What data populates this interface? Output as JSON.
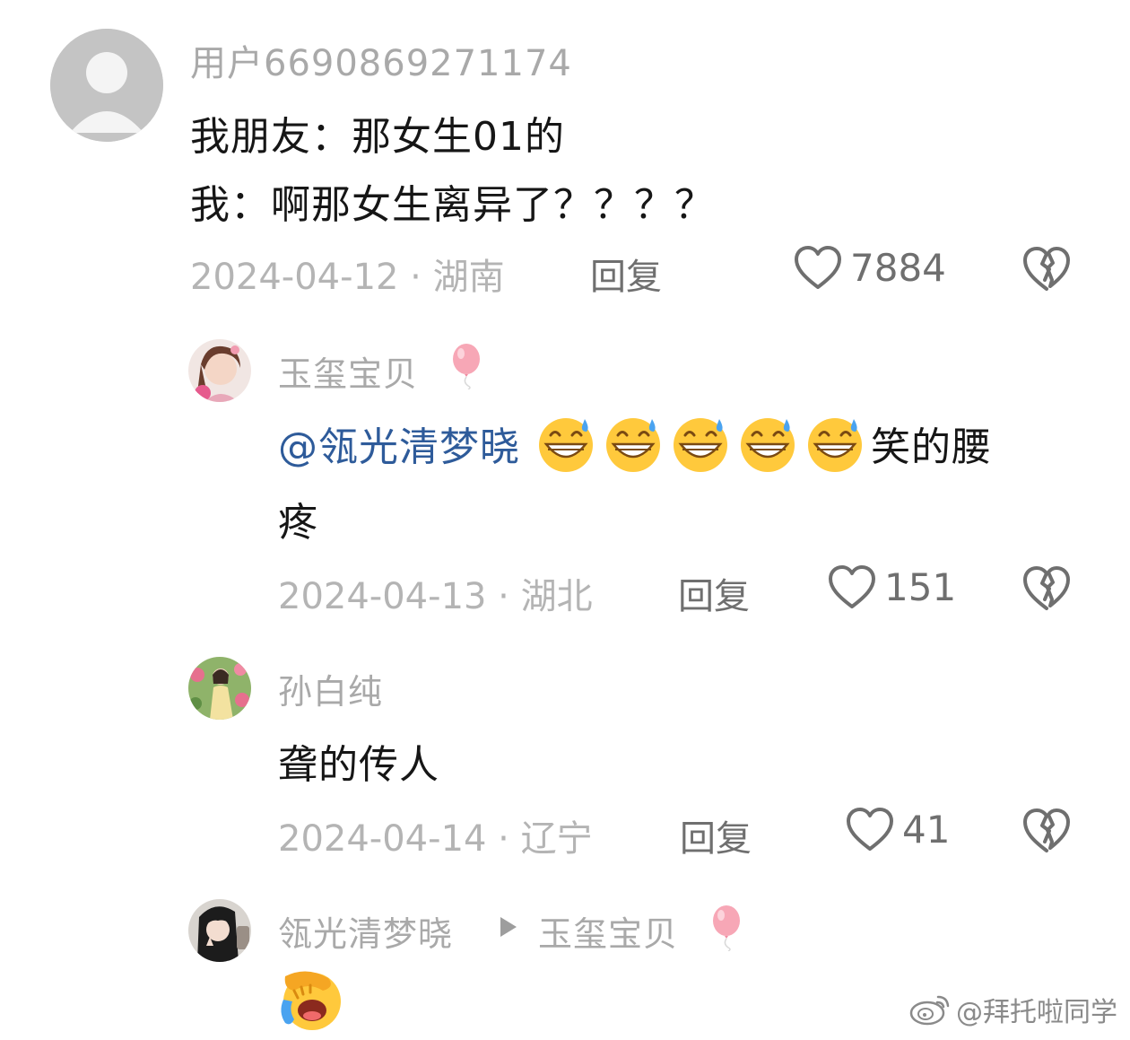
{
  "comment": {
    "username": "用户6690869271174",
    "lines": [
      "我朋友：那女生01的",
      "我：啊那女生离异了？？？？"
    ],
    "date_location": "2024-04-12 · 湖南",
    "reply_label": "回复",
    "likes": "7884"
  },
  "replies": [
    {
      "username": "玉玺宝贝",
      "mention": "@瓴光清梦晓",
      "emoji_count": 5,
      "text_after": "笑的腰",
      "text_line2": "疼",
      "date_location": "2024-04-13 · 湖北",
      "reply_label": "回复",
      "likes": "151"
    },
    {
      "username": "孙白纯",
      "text": "聋的传人",
      "date_location": "2024-04-14 · 辽宁",
      "reply_label": "回复",
      "likes": "41"
    },
    {
      "username": "瓴光清梦晓",
      "reply_to": "玉玺宝贝"
    }
  ],
  "watermark": "@拜托啦同学",
  "icons": {
    "like": "heart-outline-icon",
    "dislike": "broken-heart-icon",
    "balloon": "pink-balloon-icon",
    "sweat_grin": "grinning-sweat-emoji",
    "facepalm": "facepalm-laugh-emoji"
  },
  "colors": {
    "mention": "#2e5b9a",
    "meta": "#b4b4b4",
    "username": "#a9a9a9",
    "balloon": "#f7a7b6"
  }
}
